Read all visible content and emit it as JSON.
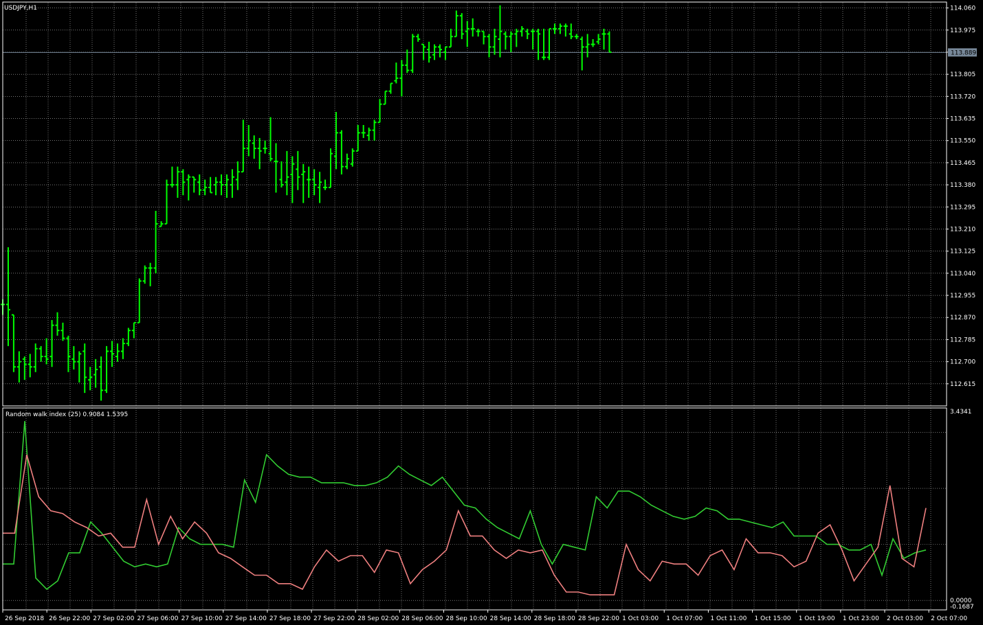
{
  "main_title": "USDJPY,H1",
  "current_price_label": "113.889",
  "indicator_title": "Random walk index (25) 0.9084 1.5395",
  "colors": {
    "background": "#000000",
    "grid": "#c0c0c0",
    "bars": "#00ff00",
    "rwi_high": "#32cd32",
    "rwi_low": "#f08080",
    "current_price_line": "#778899",
    "text": "#ffffff"
  },
  "chart_data": [
    {
      "type": "ohlc",
      "symbol": "USDJPY",
      "timeframe": "H1",
      "ylim": [
        112.53,
        114.08
      ],
      "y_ticks": [
        "114.060",
        "113.975",
        "113.890",
        "113.805",
        "113.720",
        "113.635",
        "113.550",
        "113.465",
        "113.380",
        "113.295",
        "113.210",
        "113.125",
        "113.040",
        "112.955",
        "112.870",
        "112.785",
        "112.700",
        "112.615"
      ],
      "current_price": 113.889,
      "x_labels": [
        "26 Sep 2018",
        "26 Sep 22:00",
        "27 Sep 02:00",
        "27 Sep 06:00",
        "27 Sep 10:00",
        "27 Sep 14:00",
        "27 Sep 18:00",
        "27 Sep 22:00",
        "28 Sep 02:00",
        "28 Sep 06:00",
        "28 Sep 10:00",
        "28 Sep 14:00",
        "28 Sep 18:00",
        "28 Sep 22:00",
        "1 Oct 03:00",
        "1 Oct 07:00",
        "1 Oct 11:00",
        "1 Oct 15:00",
        "1 Oct 19:00",
        "1 Oct 23:00",
        "2 Oct 03:00",
        "2 Oct 07:00"
      ],
      "bars": [
        {
          "o": 112.92,
          "h": 112.94,
          "l": 112.88,
          "c": 112.92
        },
        {
          "o": 112.92,
          "h": 113.14,
          "l": 112.76,
          "c": 112.9
        },
        {
          "o": 112.88,
          "h": 112.88,
          "l": 112.66,
          "c": 112.68
        },
        {
          "o": 112.68,
          "h": 112.74,
          "l": 112.62,
          "c": 112.7
        },
        {
          "o": 112.71,
          "h": 112.72,
          "l": 112.63,
          "c": 112.69
        },
        {
          "o": 112.69,
          "h": 112.73,
          "l": 112.64,
          "c": 112.68
        },
        {
          "o": 112.68,
          "h": 112.77,
          "l": 112.66,
          "c": 112.75
        },
        {
          "o": 112.75,
          "h": 112.76,
          "l": 112.7,
          "c": 112.72
        },
        {
          "o": 112.72,
          "h": 112.79,
          "l": 112.69,
          "c": 112.71
        },
        {
          "o": 112.72,
          "h": 112.86,
          "l": 112.68,
          "c": 112.84
        },
        {
          "o": 112.84,
          "h": 112.89,
          "l": 112.8,
          "c": 112.82
        },
        {
          "o": 112.82,
          "h": 112.85,
          "l": 112.78,
          "c": 112.79
        },
        {
          "o": 112.79,
          "h": 112.8,
          "l": 112.66,
          "c": 112.72
        },
        {
          "o": 112.71,
          "h": 112.76,
          "l": 112.67,
          "c": 112.7
        },
        {
          "o": 112.7,
          "h": 112.74,
          "l": 112.62,
          "c": 112.73
        },
        {
          "o": 112.74,
          "h": 112.77,
          "l": 112.58,
          "c": 112.64
        },
        {
          "o": 112.63,
          "h": 112.68,
          "l": 112.59,
          "c": 112.64
        },
        {
          "o": 112.65,
          "h": 112.71,
          "l": 112.6,
          "c": 112.67
        },
        {
          "o": 112.68,
          "h": 112.72,
          "l": 112.55,
          "c": 112.59
        },
        {
          "o": 112.59,
          "h": 112.76,
          "l": 112.58,
          "c": 112.74
        },
        {
          "o": 112.74,
          "h": 112.78,
          "l": 112.68,
          "c": 112.73
        },
        {
          "o": 112.72,
          "h": 112.77,
          "l": 112.7,
          "c": 112.74
        },
        {
          "o": 112.74,
          "h": 112.79,
          "l": 112.71,
          "c": 112.77
        },
        {
          "o": 112.77,
          "h": 112.83,
          "l": 112.76,
          "c": 112.82
        },
        {
          "o": 112.82,
          "h": 112.85,
          "l": 112.79,
          "c": 112.85
        },
        {
          "o": 112.85,
          "h": 113.02,
          "l": 112.85,
          "c": 113.01
        },
        {
          "o": 113.01,
          "h": 113.07,
          "l": 113.0,
          "c": 113.06
        },
        {
          "o": 113.06,
          "h": 113.08,
          "l": 112.99,
          "c": 113.06
        },
        {
          "o": 113.06,
          "h": 113.28,
          "l": 113.04,
          "c": 113.23
        },
        {
          "o": 113.22,
          "h": 113.24,
          "l": 113.22,
          "c": 113.23
        },
        {
          "o": 113.23,
          "h": 113.4,
          "l": 113.23,
          "c": 113.38
        },
        {
          "o": 113.38,
          "h": 113.45,
          "l": 113.37,
          "c": 113.38
        },
        {
          "o": 113.38,
          "h": 113.45,
          "l": 113.33,
          "c": 113.43
        },
        {
          "o": 113.43,
          "h": 113.44,
          "l": 113.34,
          "c": 113.39
        },
        {
          "o": 113.4,
          "h": 113.42,
          "l": 113.32,
          "c": 113.41
        },
        {
          "o": 113.41,
          "h": 113.41,
          "l": 113.35,
          "c": 113.4
        },
        {
          "o": 113.39,
          "h": 113.42,
          "l": 113.34,
          "c": 113.36
        },
        {
          "o": 113.36,
          "h": 113.4,
          "l": 113.34,
          "c": 113.37
        },
        {
          "o": 113.37,
          "h": 113.41,
          "l": 113.35,
          "c": 113.35
        },
        {
          "o": 113.38,
          "h": 113.41,
          "l": 113.34,
          "c": 113.39
        },
        {
          "o": 113.39,
          "h": 113.42,
          "l": 113.34,
          "c": 113.38
        },
        {
          "o": 113.38,
          "h": 113.42,
          "l": 113.33,
          "c": 113.4
        },
        {
          "o": 113.38,
          "h": 113.44,
          "l": 113.33,
          "c": 113.41
        },
        {
          "o": 113.4,
          "h": 113.47,
          "l": 113.36,
          "c": 113.43
        },
        {
          "o": 113.43,
          "h": 113.63,
          "l": 113.43,
          "c": 113.52
        },
        {
          "o": 113.52,
          "h": 113.61,
          "l": 113.49,
          "c": 113.55
        },
        {
          "o": 113.54,
          "h": 113.57,
          "l": 113.48,
          "c": 113.52
        },
        {
          "o": 113.52,
          "h": 113.56,
          "l": 113.44,
          "c": 113.51
        },
        {
          "o": 113.52,
          "h": 113.55,
          "l": 113.5,
          "c": 113.52
        },
        {
          "o": 113.5,
          "h": 113.64,
          "l": 113.47,
          "c": 113.48
        },
        {
          "o": 113.47,
          "h": 113.54,
          "l": 113.35,
          "c": 113.47
        },
        {
          "o": 113.4,
          "h": 113.47,
          "l": 113.37,
          "c": 113.38
        },
        {
          "o": 113.39,
          "h": 113.51,
          "l": 113.34,
          "c": 113.41
        },
        {
          "o": 113.42,
          "h": 113.49,
          "l": 113.31,
          "c": 113.46
        },
        {
          "o": 113.44,
          "h": 113.51,
          "l": 113.36,
          "c": 113.41
        },
        {
          "o": 113.42,
          "h": 113.46,
          "l": 113.31,
          "c": 113.43
        },
        {
          "o": 113.4,
          "h": 113.45,
          "l": 113.33,
          "c": 113.4
        },
        {
          "o": 113.4,
          "h": 113.44,
          "l": 113.34,
          "c": 113.38
        },
        {
          "o": 113.37,
          "h": 113.43,
          "l": 113.31,
          "c": 113.39
        },
        {
          "o": 113.37,
          "h": 113.4,
          "l": 113.36,
          "c": 113.37
        },
        {
          "o": 113.37,
          "h": 113.52,
          "l": 113.37,
          "c": 113.5
        },
        {
          "o": 113.49,
          "h": 113.66,
          "l": 113.44,
          "c": 113.58
        },
        {
          "o": 113.58,
          "h": 113.59,
          "l": 113.42,
          "c": 113.45
        },
        {
          "o": 113.45,
          "h": 113.5,
          "l": 113.44,
          "c": 113.48
        },
        {
          "o": 113.46,
          "h": 113.52,
          "l": 113.45,
          "c": 113.51
        },
        {
          "o": 113.51,
          "h": 113.61,
          "l": 113.51,
          "c": 113.58
        },
        {
          "o": 113.58,
          "h": 113.61,
          "l": 113.56,
          "c": 113.58
        },
        {
          "o": 113.57,
          "h": 113.6,
          "l": 113.55,
          "c": 113.59
        },
        {
          "o": 113.59,
          "h": 113.63,
          "l": 113.55,
          "c": 113.62
        },
        {
          "o": 113.62,
          "h": 113.71,
          "l": 113.62,
          "c": 113.69
        },
        {
          "o": 113.69,
          "h": 113.74,
          "l": 113.69,
          "c": 113.74
        },
        {
          "o": 113.74,
          "h": 113.77,
          "l": 113.73,
          "c": 113.77
        },
        {
          "o": 113.78,
          "h": 113.85,
          "l": 113.77,
          "c": 113.79
        },
        {
          "o": 113.79,
          "h": 113.86,
          "l": 113.72,
          "c": 113.84
        },
        {
          "o": 113.84,
          "h": 113.9,
          "l": 113.81,
          "c": 113.82
        },
        {
          "o": 113.82,
          "h": 113.96,
          "l": 113.81,
          "c": 113.95
        },
        {
          "o": 113.95,
          "h": 113.96,
          "l": 113.93,
          "c": 113.94
        },
        {
          "o": 113.92,
          "h": 113.92,
          "l": 113.86,
          "c": 113.91
        },
        {
          "o": 113.9,
          "h": 113.93,
          "l": 113.85,
          "c": 113.87
        },
        {
          "o": 113.88,
          "h": 113.92,
          "l": 113.86,
          "c": 113.91
        },
        {
          "o": 113.91,
          "h": 113.92,
          "l": 113.87,
          "c": 113.9
        },
        {
          "o": 113.89,
          "h": 113.91,
          "l": 113.86,
          "c": 113.91
        },
        {
          "o": 113.91,
          "h": 113.98,
          "l": 113.91,
          "c": 113.95
        },
        {
          "o": 113.95,
          "h": 114.05,
          "l": 113.95,
          "c": 114.03
        },
        {
          "o": 114.03,
          "h": 114.04,
          "l": 113.94,
          "c": 113.96
        },
        {
          "o": 113.97,
          "h": 114.01,
          "l": 113.91,
          "c": 113.98
        },
        {
          "o": 113.98,
          "h": 114.02,
          "l": 113.95,
          "c": 113.98
        },
        {
          "o": 113.97,
          "h": 113.98,
          "l": 113.95,
          "c": 113.97
        },
        {
          "o": 113.97,
          "h": 113.97,
          "l": 113.92,
          "c": 113.95
        },
        {
          "o": 113.95,
          "h": 113.96,
          "l": 113.87,
          "c": 113.91
        },
        {
          "o": 113.91,
          "h": 113.98,
          "l": 113.88,
          "c": 113.95
        },
        {
          "o": 113.94,
          "h": 114.07,
          "l": 113.87,
          "c": 113.97
        },
        {
          "o": 113.96,
          "h": 113.97,
          "l": 113.9,
          "c": 113.95
        },
        {
          "o": 113.95,
          "h": 113.97,
          "l": 113.89,
          "c": 113.96
        },
        {
          "o": 113.96,
          "h": 113.98,
          "l": 113.91,
          "c": 113.97
        },
        {
          "o": 113.97,
          "h": 113.99,
          "l": 113.95,
          "c": 113.98
        },
        {
          "o": 113.97,
          "h": 113.98,
          "l": 113.94,
          "c": 113.96
        },
        {
          "o": 113.97,
          "h": 113.98,
          "l": 113.9,
          "c": 113.97
        },
        {
          "o": 113.97,
          "h": 113.98,
          "l": 113.86,
          "c": 113.96
        },
        {
          "o": 113.87,
          "h": 113.98,
          "l": 113.86,
          "c": 113.87
        },
        {
          "o": 113.87,
          "h": 113.98,
          "l": 113.86,
          "c": 113.98
        },
        {
          "o": 113.98,
          "h": 114.0,
          "l": 113.96,
          "c": 113.98
        },
        {
          "o": 113.98,
          "h": 114.0,
          "l": 113.96,
          "c": 113.99
        },
        {
          "o": 113.99,
          "h": 114.0,
          "l": 113.95,
          "c": 113.99
        },
        {
          "o": 113.96,
          "h": 114.0,
          "l": 113.94,
          "c": 113.95
        },
        {
          "o": 113.95,
          "h": 113.96,
          "l": 113.94,
          "c": 113.95
        },
        {
          "o": 113.94,
          "h": 113.95,
          "l": 113.82,
          "c": 113.91
        },
        {
          "o": 113.91,
          "h": 113.96,
          "l": 113.87,
          "c": 113.92
        },
        {
          "o": 113.92,
          "h": 113.94,
          "l": 113.91,
          "c": 113.92
        },
        {
          "o": 113.93,
          "h": 113.96,
          "l": 113.92,
          "c": 113.94
        },
        {
          "o": 113.96,
          "h": 113.98,
          "l": 113.9,
          "c": 113.96
        },
        {
          "o": 113.96,
          "h": 113.97,
          "l": 113.89,
          "c": 113.89
        }
      ]
    },
    {
      "type": "line",
      "indicator": "Random walk index",
      "period": 25,
      "ylim": [
        -0.1687,
        3.4341
      ],
      "y_ticks": [
        "3.4341",
        "0.0000",
        "-0.1687"
      ],
      "last_values": [
        0.9084,
        1.5395
      ],
      "series": [
        {
          "values": [
            0.65,
            0.65,
            3.2,
            0.4,
            0.2,
            0.35,
            0.85,
            0.85,
            1.4,
            1.2,
            0.95,
            0.7,
            0.6,
            0.65,
            0.6,
            0.65,
            1.3,
            1.1,
            1.0,
            1.0,
            1.0,
            0.95,
            2.15,
            1.75,
            2.6,
            2.4,
            2.25,
            2.2,
            2.2,
            2.1,
            2.1,
            2.1,
            2.05,
            2.05,
            2.1,
            2.2,
            2.4,
            2.25,
            2.15,
            2.05,
            2.2,
            1.95,
            1.7,
            1.65,
            1.45,
            1.3,
            1.2,
            1.1,
            1.6,
            1.0,
            0.65,
            1.0,
            0.95,
            0.9,
            1.85,
            1.65,
            1.95,
            1.95,
            1.85,
            1.7,
            1.6,
            1.5,
            1.45,
            1.5,
            1.65,
            1.6,
            1.45,
            1.45,
            1.4,
            1.35,
            1.3,
            1.4,
            1.15,
            1.15,
            1.15,
            1.0,
            1.0,
            0.9,
            0.9,
            1.0,
            0.45,
            1.1,
            0.75,
            0.85,
            0.9
          ]
        },
        {
          "values": [
            1.2,
            1.2,
            2.6,
            1.85,
            1.6,
            1.55,
            1.4,
            1.3,
            1.15,
            1.2,
            0.95,
            0.95,
            1.8,
            1.0,
            1.5,
            1.1,
            1.4,
            1.2,
            0.85,
            0.75,
            0.6,
            0.45,
            0.45,
            0.3,
            0.3,
            0.2,
            0.6,
            0.9,
            0.7,
            0.8,
            0.8,
            0.5,
            0.9,
            0.85,
            0.3,
            0.55,
            0.7,
            0.9,
            1.6,
            1.15,
            1.15,
            0.9,
            0.75,
            0.9,
            0.85,
            0.9,
            0.45,
            0.15,
            0.15,
            0.1,
            0.1,
            0.1,
            1.0,
            0.55,
            0.35,
            0.7,
            0.65,
            0.65,
            0.45,
            0.8,
            0.9,
            0.55,
            1.1,
            0.85,
            0.85,
            0.8,
            0.6,
            0.7,
            1.2,
            1.35,
            0.9,
            0.35,
            0.65,
            0.95,
            2.05,
            0.75,
            0.6,
            1.65
          ]
        }
      ]
    }
  ]
}
